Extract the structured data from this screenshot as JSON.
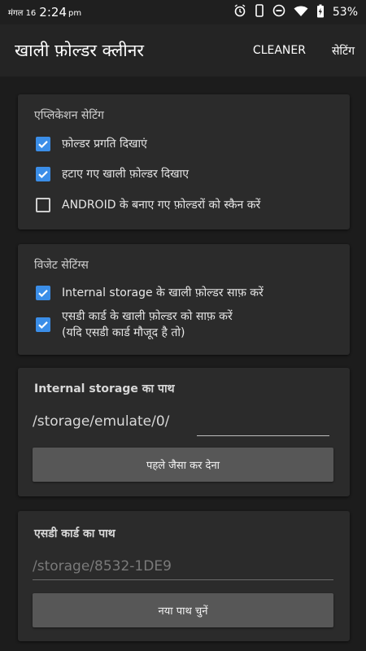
{
  "status": {
    "date": "मंगल 16",
    "time": "2:24",
    "ampm": "pm",
    "battery": "53%",
    "icons": [
      "alarm-icon",
      "phone-vibrate-icon",
      "dnd-icon",
      "wifi-icon",
      "battery-charging-icon"
    ]
  },
  "appbar": {
    "title": "खाली फ़ोल्डर क्लीनर",
    "action_cleaner": "CLEANER",
    "action_settings": "सेटिंग"
  },
  "app_settings": {
    "heading": "एप्लिकेशन सेटिंग",
    "items": [
      {
        "label": "फ़ोल्डर प्रगति दिखाएं",
        "checked": true
      },
      {
        "label": "हटाए गए खाली फ़ोल्डर दिखाए",
        "checked": true
      },
      {
        "label": "ANDROID के बनाए गए फ़ोल्डरों को स्कैन करें",
        "checked": false
      }
    ]
  },
  "widget_settings": {
    "heading": "विजेट सेटिंग्स",
    "items": [
      {
        "label": "Internal storage के खाली फ़ोल्डर साफ़ करें",
        "checked": true
      },
      {
        "label": "एसडी कार्ड के खाली फ़ोल्डर को साफ़ करें",
        "label2": "(यदि एसडी कार्ड मौजूद है तो)",
        "checked": true
      }
    ]
  },
  "internal_path": {
    "label": "Internal storage का पाथ",
    "prefix": "/storage/emulate/0/",
    "value": "",
    "button": "पहले जैसा कर देना"
  },
  "sd_path": {
    "label": "एसडी कार्ड का पाथ",
    "placeholder": "/storage/8532-1DE9",
    "button": "नया पाथ चुनें"
  },
  "colors": {
    "accent": "#3b8ee8",
    "background": "#1c1c1c",
    "card": "#2b2b2b",
    "button": "#575757"
  }
}
